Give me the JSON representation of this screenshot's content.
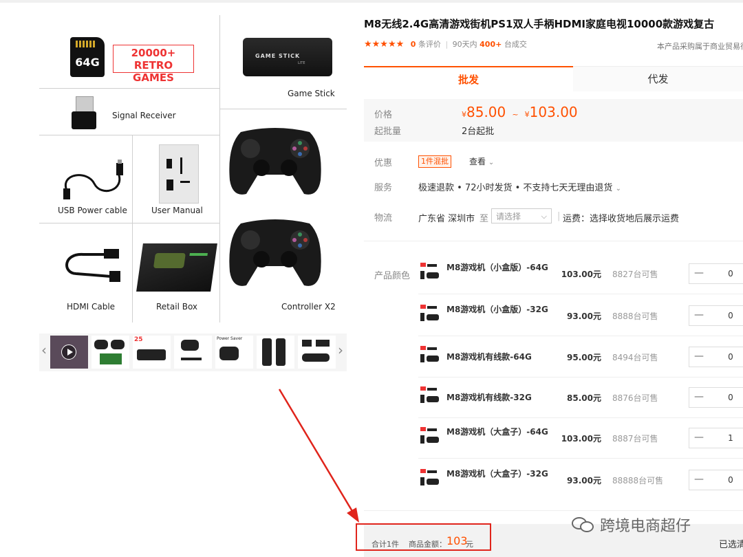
{
  "gallery": {
    "cells": {
      "sd_card": {
        "size": "64G",
        "promo_line1": "20000+",
        "promo_line2": "RETRO GAMES"
      },
      "game_stick": {
        "label": "Game Stick",
        "brand": "GAME STICK",
        "sub": "LITE"
      },
      "signal_receiver": {
        "label": "Signal Receiver"
      },
      "usb_cable": {
        "label": "USB Power cable"
      },
      "user_manual": {
        "label": "User Manual"
      },
      "controllers": {
        "label": "Controller X2"
      },
      "hdmi_cable": {
        "label": "HDMI Cable"
      },
      "retail_box": {
        "label": "Retail Box"
      }
    },
    "thumbnails": {
      "prev": "‹",
      "next": "›",
      "t2_text": "25",
      "t4_text": "Power Saver"
    }
  },
  "product": {
    "title": "M8无线2.4G高清游戏街机PS1双人手柄HDMI家庭电视10000款游戏复古",
    "stars": "★★★★★",
    "review_count": "0",
    "review_label": "条评价",
    "sales_period": "90天内",
    "sales_count": "400+",
    "sales_unit": "台成交",
    "notice": "本产品采购属于商业贸易行"
  },
  "tabs": {
    "wholesale": "批发",
    "dropship": "代发"
  },
  "price": {
    "label": "价格",
    "currency": "¥",
    "low": "85.00",
    "sep": "~",
    "high": "103.00",
    "moq_label": "起批量",
    "moq_value": "2台起批"
  },
  "promo": {
    "label": "优惠",
    "badge": "1件混批",
    "view": "查看",
    "chev": "⌄"
  },
  "service": {
    "label": "服务",
    "value": "极速退款 • 72小时发货 • 不支持七天无理由退货",
    "chev": "⌄"
  },
  "logistics": {
    "label": "物流",
    "origin": "广东省 深圳市",
    "to": "至",
    "select_placeholder": "请选择",
    "chev": "⌵",
    "fee": "运费：选择收货地后展示运费"
  },
  "variants": {
    "label": "产品颜色",
    "items": [
      {
        "name": "M8游戏机（小盒版）-64G",
        "price": "103.00元",
        "stock": "8827台可售",
        "minus": "—",
        "qty": "0"
      },
      {
        "name": "M8游戏机（小盒版）-32G",
        "price": "93.00元",
        "stock": "8888台可售",
        "minus": "—",
        "qty": "0"
      },
      {
        "name": "M8游戏机有线款-64G",
        "price": "95.00元",
        "stock": "8494台可售",
        "minus": "—",
        "qty": "0"
      },
      {
        "name": "M8游戏机有线款-32G",
        "price": "85.00元",
        "stock": "8876台可售",
        "minus": "—",
        "qty": "0"
      },
      {
        "name": "M8游戏机（大盒子）-64G",
        "price": "103.00元",
        "stock": "8887台可售",
        "minus": "—",
        "qty": "1"
      },
      {
        "name": "M8游戏机（大盒子）-32G",
        "price": "93.00元",
        "stock": "88888台可售",
        "minus": "—",
        "qty": "0"
      }
    ]
  },
  "summary": {
    "count": "合计1件",
    "amount_label": "商品金额：",
    "amount": "103",
    "unit": "元",
    "selected": "已选清"
  },
  "watermark": {
    "text": "跨境电商超仔"
  },
  "colors": {
    "accent": "#ff5000",
    "annotation_red": "#e0241b",
    "text": "#333333",
    "muted": "#888888"
  }
}
